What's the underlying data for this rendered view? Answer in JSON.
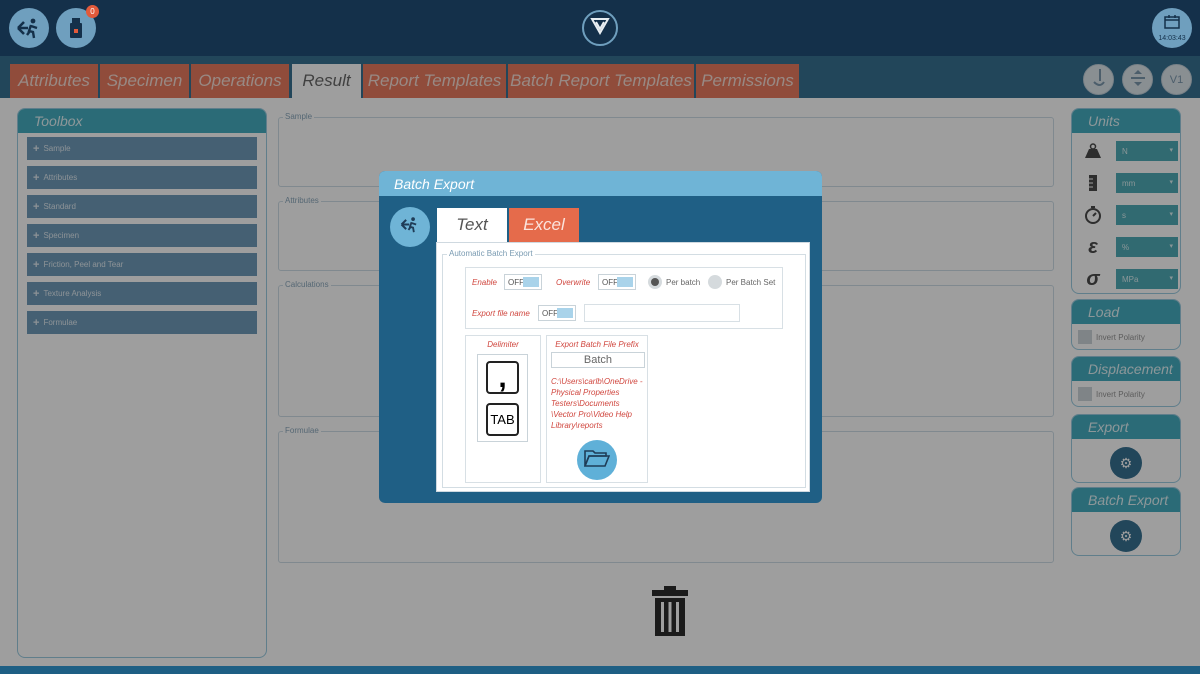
{
  "header": {
    "notification_count": "0",
    "clock_time": "14:03:43",
    "icons": [
      "exit-icon",
      "usb-drive-icon",
      "vector-logo-icon",
      "calendar-clock-icon"
    ]
  },
  "tabs": [
    {
      "label": "Attributes",
      "active": false
    },
    {
      "label": "Specimen",
      "active": false
    },
    {
      "label": "Operations",
      "active": false
    },
    {
      "label": "Result",
      "active": true
    },
    {
      "label": "Report Templates",
      "active": false
    },
    {
      "label": "Batch Report Templates",
      "active": false
    },
    {
      "label": "Permissions",
      "active": false
    }
  ],
  "toolbar": {
    "version_label": "V1"
  },
  "toolbox": {
    "title": "Toolbox",
    "items": [
      "Sample",
      "Attributes",
      "Standard",
      "Specimen",
      "Friction, Peel and Tear",
      "Texture Analysis",
      "Formulae"
    ]
  },
  "sections": [
    "Sample",
    "Attributes",
    "Calculations",
    "Formulae"
  ],
  "units": {
    "title": "Units",
    "rows": [
      {
        "icon": "weight-icon",
        "value": "N"
      },
      {
        "icon": "length-icon",
        "value": "mm"
      },
      {
        "icon": "timer-icon",
        "value": "s"
      },
      {
        "icon": "epsilon-icon",
        "value": "%"
      },
      {
        "icon": "sigma-icon",
        "value": "MPa"
      }
    ]
  },
  "load": {
    "title": "Load",
    "option": "Invert Polarity"
  },
  "displacement": {
    "title": "Displacement",
    "option": "Invert Polarity"
  },
  "export_panel": {
    "title": "Export"
  },
  "batch_export_panel": {
    "title": "Batch Export"
  },
  "modal": {
    "title": "Batch Export",
    "tabs": [
      {
        "label": "Text",
        "active": true
      },
      {
        "label": "Excel",
        "active": false
      }
    ],
    "group_label": "Automatic Batch Export",
    "enable_label": "Enable",
    "enable_value": "OFF",
    "overwrite_label": "Overwrite",
    "overwrite_value": "OFF",
    "per_batch_label": "Per batch",
    "per_batch_set_label": "Per Batch Set",
    "selected_mode": "Per batch",
    "export_file_name_label": "Export file name",
    "export_file_name_value": "OFF",
    "delimiter_label": "Delimiter",
    "delimiter_options": [
      ",",
      "TAB"
    ],
    "prefix_label": "Export Batch File Prefix",
    "prefix_value": "Batch",
    "path_lines": [
      "C:\\Users\\carlb\\OneDrive -",
      "Physical Properties",
      "Testers\\Documents",
      "\\Vector Pro\\Video Help",
      "Library\\reports"
    ]
  },
  "colors": {
    "topbar": "#14304a",
    "tabbar": "#1e5f84",
    "tab": "#e56b4b",
    "teal_header": "#2fa3b8",
    "modal_header": "#6fb4d6"
  }
}
